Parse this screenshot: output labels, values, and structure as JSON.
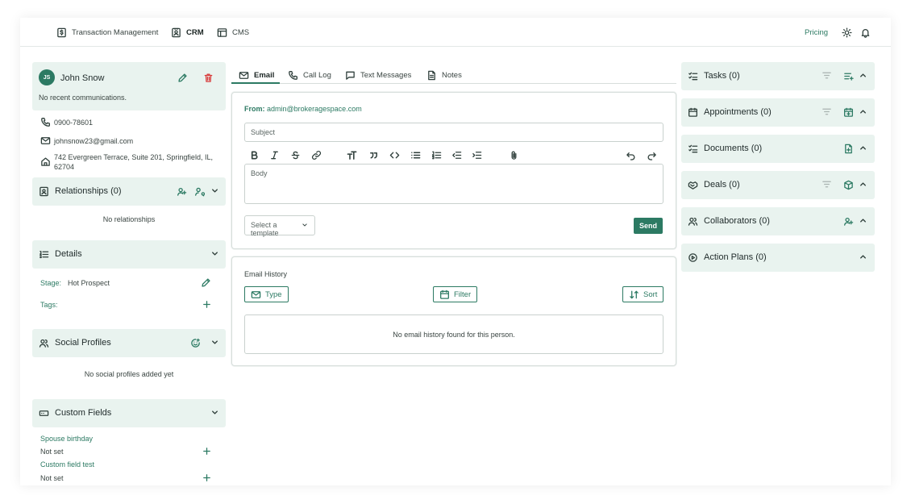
{
  "nav": {
    "items": [
      {
        "label": "Transaction Management",
        "icon": "dollar-document-icon"
      },
      {
        "label": "CRM",
        "icon": "contact-card-icon"
      },
      {
        "label": "CMS",
        "icon": "layout-icon"
      }
    ],
    "pricing": "Pricing",
    "theme_icon": "sun-icon",
    "notifications_icon": "bell-icon"
  },
  "contact": {
    "initials": "JS",
    "name": "John Snow",
    "recent": "No recent communications.",
    "phone": "0900-78601",
    "email": "johnsnow23@gmail.com",
    "address": "742 Evergreen Terrace, Suite 201, Springfield, IL, 62704"
  },
  "relationships": {
    "title": "Relationships (0)",
    "empty": "No relationships"
  },
  "details": {
    "title": "Details",
    "stage_label": "Stage:",
    "stage_value": "Hot Prospect",
    "tags_label": "Tags:"
  },
  "social": {
    "title": "Social Profiles",
    "empty": "No social profiles added yet"
  },
  "custom_fields": {
    "title": "Custom Fields",
    "items": [
      {
        "label": "Spouse birthday",
        "value": "Not set"
      },
      {
        "label": "Custom field test",
        "value": "Not set"
      }
    ]
  },
  "tabs": [
    "Email",
    "Call Log",
    "Text Messages",
    "Notes"
  ],
  "compose": {
    "from_label": "From:",
    "from_value": "admin@brokeragespace.com",
    "subject_placeholder": "Subject",
    "body_placeholder": "Body",
    "template_placeholder": "Select a template",
    "send": "Send"
  },
  "history": {
    "title": "Email History",
    "type": "Type",
    "filter": "Filter",
    "sort": "Sort",
    "empty": "No email history found for this person."
  },
  "right_panels": [
    {
      "title": "Tasks (0)",
      "icon": "checklist-icon"
    },
    {
      "title": "Appointments (0)",
      "icon": "calendar-icon"
    },
    {
      "title": "Documents (0)",
      "icon": "list-icon"
    },
    {
      "title": "Deals (0)",
      "icon": "handshake-icon"
    },
    {
      "title": "Collaborators (0)",
      "icon": "users-icon"
    },
    {
      "title": "Action Plans (0)",
      "icon": "target-icon"
    }
  ],
  "colors": {
    "accent": "#2c7a63",
    "panel": "#e9f3ef",
    "danger": "#d83a3a"
  }
}
